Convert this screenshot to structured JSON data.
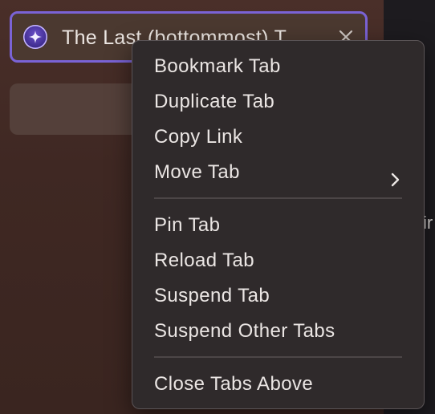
{
  "tab": {
    "title": "The Last (bottommost) T",
    "icon": "sparkle-icon",
    "close_icon": "close-icon",
    "accent": "#7a63d6"
  },
  "content": {
    "partial_text": "ir"
  },
  "context_menu": {
    "group1": [
      "Bookmark Tab",
      "Duplicate Tab",
      "Copy Link",
      "Move Tab"
    ],
    "group2": [
      "Pin Tab",
      "Reload Tab",
      "Suspend Tab",
      "Suspend Other Tabs"
    ],
    "group3": [
      "Close Tabs Above"
    ],
    "submenu_icon": "chevron-right-icon"
  }
}
